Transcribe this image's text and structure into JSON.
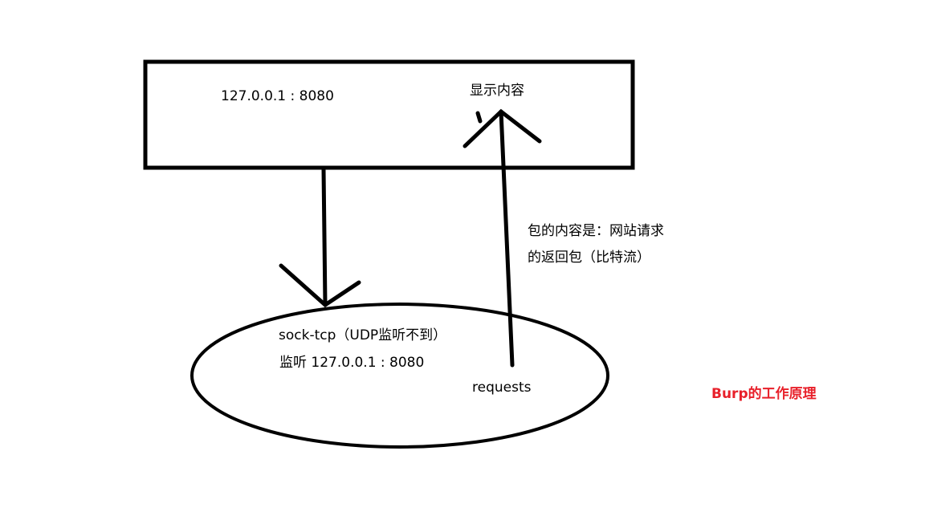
{
  "box": {
    "label_address": "127.0.0.1 : 8080",
    "label_display": "显示内容"
  },
  "packet_note": {
    "line1": "包的内容是：网站请求",
    "line2": "的返回包（比特流）"
  },
  "ellipse": {
    "line1": "sock-tcp（UDP监听不到）",
    "line2": "监听 127.0.0.1 : 8080",
    "requests": "requests"
  },
  "title": "Burp的工作原理",
  "colors": {
    "stroke": "#000000",
    "title": "#e8202a"
  }
}
